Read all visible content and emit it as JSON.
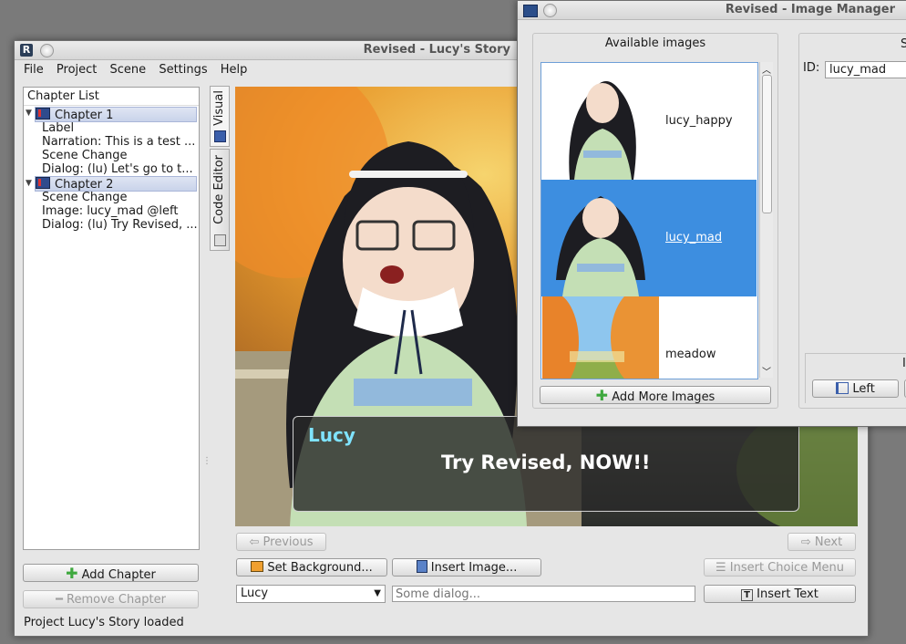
{
  "main_window": {
    "title": "Revised - Lucy's Story",
    "app_icon_letter": "R",
    "menu": [
      "File",
      "Project",
      "Scene",
      "Settings",
      "Help"
    ],
    "chapter_list_header": "Chapter List",
    "tree": [
      {
        "type": "chapter",
        "label": "Chapter 1"
      },
      {
        "type": "item",
        "label": "Label"
      },
      {
        "type": "item",
        "label": "Narration: This is a test ..."
      },
      {
        "type": "item",
        "label": "Scene Change"
      },
      {
        "type": "item",
        "label": "Dialog: (lu) Let's go to t..."
      },
      {
        "type": "chapter",
        "label": "Chapter 2"
      },
      {
        "type": "item",
        "label": "Scene Change"
      },
      {
        "type": "item",
        "label": "Image:  lucy_mad @left"
      },
      {
        "type": "item",
        "label": "Dialog: (lu) Try Revised, ..."
      }
    ],
    "add_chapter": "Add Chapter",
    "remove_chapter": "Remove Chapter",
    "tabs": {
      "visual": "Visual",
      "code_editor": "Code Editor"
    },
    "scene": {
      "speaker": "Lucy",
      "line": "Try Revised, NOW!!"
    },
    "previous": "Previous",
    "next": "Next",
    "set_background": "Set Background...",
    "insert_image": "Insert Image...",
    "insert_choice_menu": "Insert Choice Menu",
    "character_select": "Lucy",
    "dialog_placeholder": "Some dialog...",
    "insert_text": "Insert Text",
    "status": "Project Lucy's Story loaded"
  },
  "image_manager": {
    "title": "Revised - Image Manager",
    "available_images_header": "Available images",
    "images": [
      {
        "name": "lucy_happy",
        "selected": false
      },
      {
        "name": "lucy_mad",
        "selected": true
      },
      {
        "name": "meadow",
        "selected": false
      }
    ],
    "add_more_images": "Add More Images",
    "id_label": "ID:",
    "id_value": "lucy_mad",
    "right_header_fragment": "S",
    "position_fragment": "I",
    "left_button": "Left"
  },
  "colors": {
    "selection": "#3d8ee0",
    "speaker_name": "#7fe3ff",
    "accent_green": "#3ea83e"
  }
}
